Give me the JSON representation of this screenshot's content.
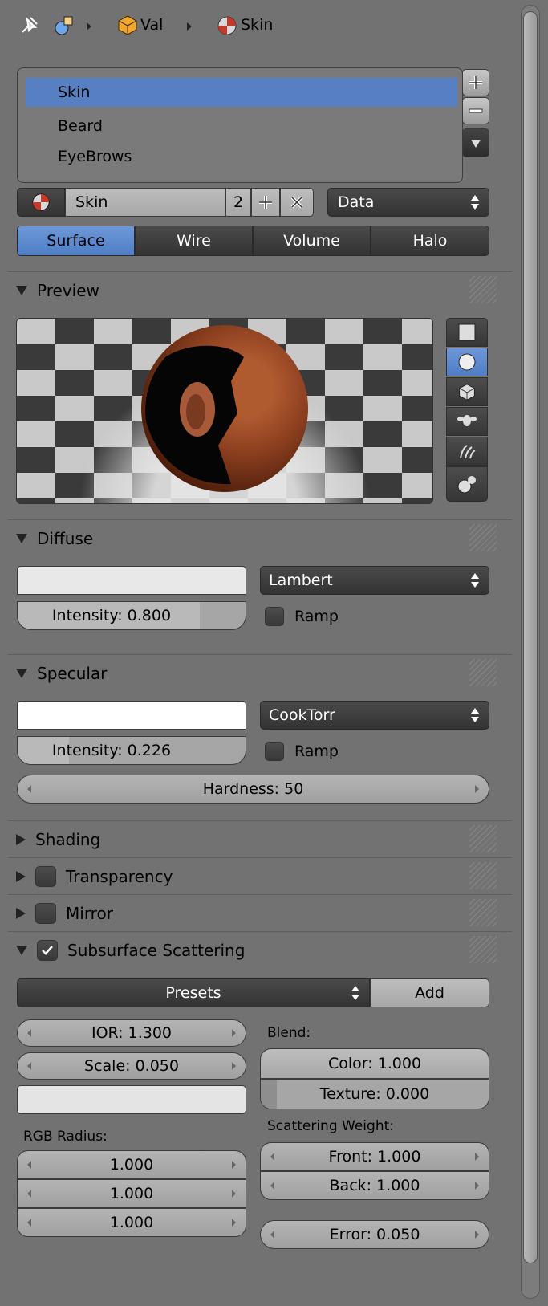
{
  "header": {
    "val_label": "Val",
    "skin_label": "Skin"
  },
  "slots": {
    "items": [
      "Skin",
      "Beard",
      "EyeBrows"
    ],
    "selected_index": 0
  },
  "material": {
    "name": "Skin",
    "users": "2",
    "link_select": "Data"
  },
  "tabs": [
    "Surface",
    "Wire",
    "Volume",
    "Halo"
  ],
  "active_tab": "Surface",
  "preview": {
    "title": "Preview"
  },
  "diffuse": {
    "title": "Diffuse",
    "color": "#e8e8e8",
    "shader": "Lambert",
    "intensity_label": "Intensity: 0.800",
    "intensity": 0.8,
    "ramp_label": "Ramp"
  },
  "specular": {
    "title": "Specular",
    "color": "#ffffff",
    "shader": "CookTorr",
    "intensity_label": "Intensity: 0.226",
    "intensity": 0.226,
    "ramp_label": "Ramp",
    "hardness_label": "Hardness: 50"
  },
  "shading": {
    "title": "Shading"
  },
  "transparency": {
    "title": "Transparency"
  },
  "mirror": {
    "title": "Mirror"
  },
  "sss": {
    "title": "Subsurface Scattering",
    "enabled": true,
    "presets_label": "Presets",
    "add_label": "Add",
    "ior_label": "IOR: 1.300",
    "scale_label": "Scale: 0.050",
    "color": "#e4e4e4",
    "rgb_radius_label": "RGB Radius:",
    "radius": [
      "1.000",
      "1.000",
      "1.000"
    ],
    "blend_label": "Blend:",
    "color_blend_label": "Color: 1.000",
    "texture_blend_label": "Texture: 0.000",
    "scattering_weight_label": "Scattering Weight:",
    "front_label": "Front: 1.000",
    "back_label": "Back: 1.000",
    "error_label": "Error: 0.050"
  },
  "colors": {
    "accent": "#5680c2",
    "panel": "#727272"
  }
}
